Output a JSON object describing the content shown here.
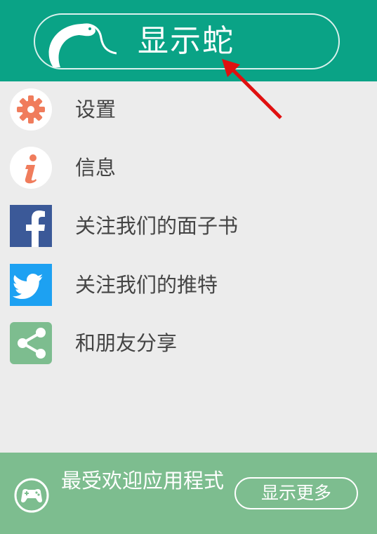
{
  "header": {
    "title": "显示蛇"
  },
  "menu": {
    "items": [
      {
        "label": "设置",
        "icon": "gear-icon"
      },
      {
        "label": "信息",
        "icon": "info-icon"
      },
      {
        "label": "关注我们的面子书",
        "icon": "facebook-icon"
      },
      {
        "label": "关注我们的推特",
        "icon": "twitter-icon"
      },
      {
        "label": "和朋友分享",
        "icon": "share-icon"
      }
    ]
  },
  "footer": {
    "text": "最受欢迎应用程式",
    "more_label": "显示更多"
  },
  "colors": {
    "header_bg": "#0aa386",
    "footer_bg": "#7dbd8f",
    "accent_orange": "#f07c5c",
    "facebook_blue": "#3b5998",
    "twitter_blue": "#1da1f2",
    "share_green": "#7dbd8f",
    "arrow_red": "#e01010"
  }
}
